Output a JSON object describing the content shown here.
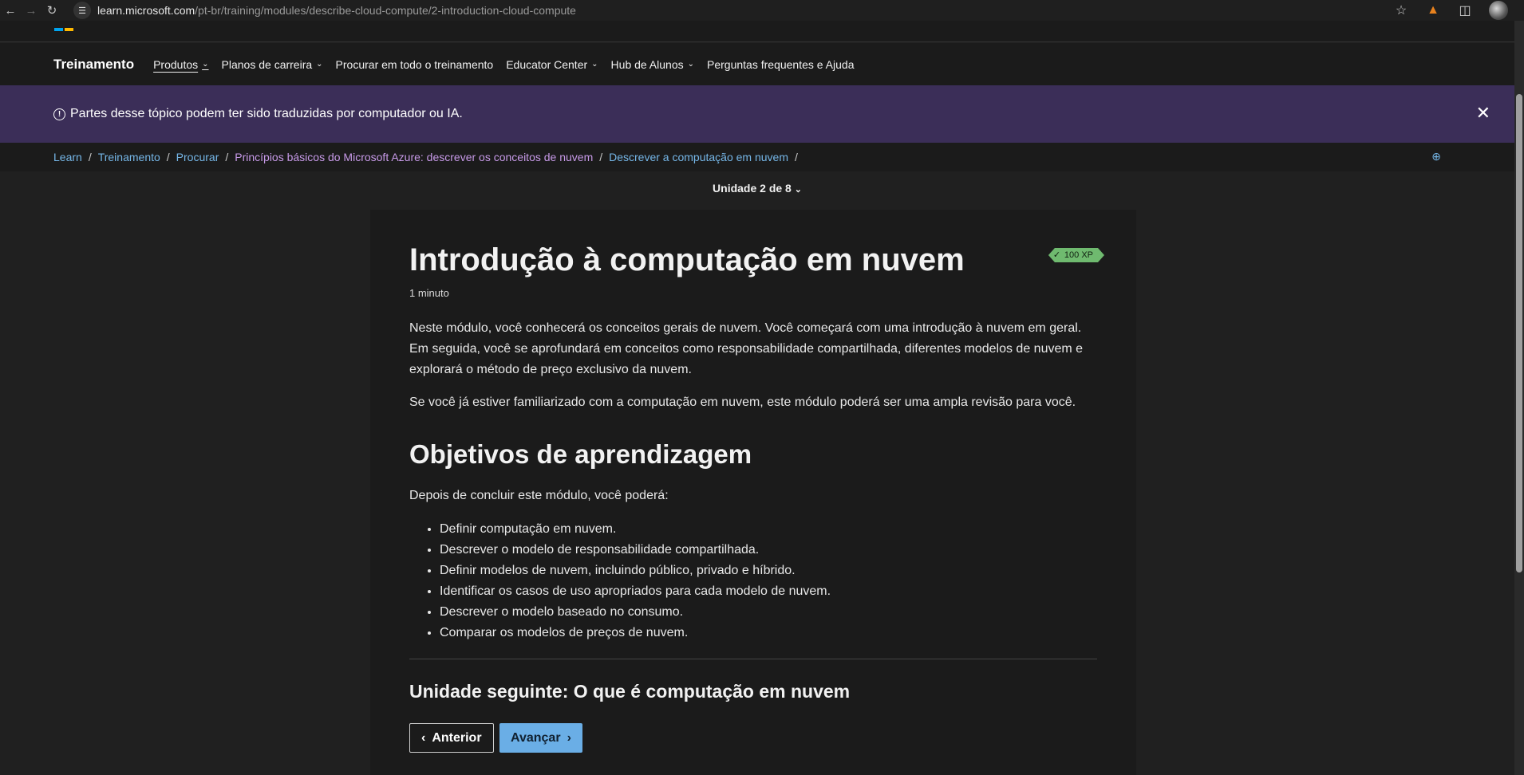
{
  "browser": {
    "url_host": "learn.microsoft.com",
    "url_path": "/pt-br/training/modules/describe-cloud-compute/2-introduction-cloud-compute"
  },
  "nav": {
    "brand": "Treinamento",
    "items": [
      {
        "label": "Produtos",
        "dropdown": true
      },
      {
        "label": "Planos de carreira",
        "dropdown": true
      },
      {
        "label": "Procurar em todo o treinamento",
        "dropdown": false
      },
      {
        "label": "Educator Center",
        "dropdown": true
      },
      {
        "label": "Hub de Alunos",
        "dropdown": true
      },
      {
        "label": "Perguntas frequentes e Ajuda",
        "dropdown": false
      }
    ]
  },
  "banner": {
    "text": "Partes desse tópico podem ter sido traduzidas por computador ou IA."
  },
  "breadcrumb": [
    "Learn",
    "Treinamento",
    "Procurar",
    "Princípios básicos do Microsoft Azure: descrever os conceitos de nuvem",
    "Descrever a computação em nuvem"
  ],
  "unit_selector": "Unidade 2 de 8",
  "content": {
    "title": "Introdução à computação em nuvem",
    "xp": "100 XP",
    "duration": "1 minuto",
    "intro_p1": "Neste módulo, você conhecerá os conceitos gerais de nuvem. Você começará com uma introdução à nuvem em geral. Em seguida, você se aprofundará em conceitos como responsabilidade compartilhada, diferentes modelos de nuvem e explorará o método de preço exclusivo da nuvem.",
    "intro_p2": "Se você já estiver familiarizado com a computação em nuvem, este módulo poderá ser uma ampla revisão para você.",
    "objectives_heading": "Objetivos de aprendizagem",
    "objectives_lead": "Depois de concluir este módulo, você poderá:",
    "objectives": [
      "Definir computação em nuvem.",
      "Descrever o modelo de responsabilidade compartilhada.",
      "Definir modelos de nuvem, incluindo público, privado e híbrido.",
      "Identificar os casos de uso apropriados para cada modelo de nuvem.",
      "Descrever o modelo baseado no consumo.",
      "Comparar os modelos de preços de nuvem."
    ],
    "next_unit_heading": "Unidade seguinte: O que é computação em nuvem",
    "prev_button": "Anterior",
    "next_button": "Avançar"
  }
}
